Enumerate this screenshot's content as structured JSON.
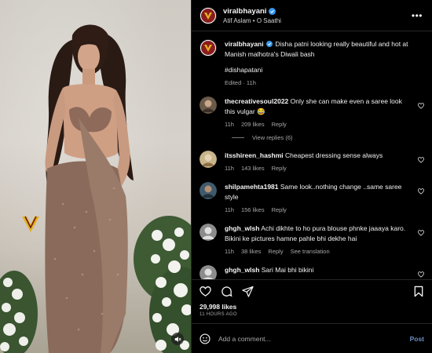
{
  "header": {
    "username": "viralbhayani",
    "subtitle": "Atif Aslam • O Saathi",
    "more_icon": "more-horizontal-icon"
  },
  "caption": {
    "username": "viralbhayani",
    "text": "Disha patni looking really beautiful and hot at Manish malhotra's Diwali bash",
    "hashtag": "#dishapatani",
    "edited": "Edited · 11h"
  },
  "comments": [
    {
      "username": "thecreativesoul2022",
      "text": "Only she can make even a saree look this vulgar 😂",
      "time": "11h",
      "likes": "209 likes",
      "reply": "Reply",
      "avatar_color": "#6b5a4a"
    },
    {
      "username": "itsshireen_hashmi",
      "text": "Cheapest dressing sense always",
      "time": "11h",
      "likes": "143 likes",
      "reply": "Reply",
      "avatar_color": "#c8b48a"
    },
    {
      "username": "shilpamehta1981",
      "text": "Same look..nothing change ..same saree style",
      "time": "11h",
      "likes": "156 likes",
      "reply": "Reply",
      "avatar_color": "#3f5a6b"
    },
    {
      "username": "ghgh_wlsh",
      "text": "Achi dikhte to ho pura blouse phnke jaaaya karo. Bikini ke pictures hamne pahle bhi dekhe hai",
      "time": "11h",
      "likes": "38 likes",
      "reply": "Reply",
      "translation": "See translation",
      "avatar_color": "#8c8c8c"
    },
    {
      "username": "ghgh_wlsh",
      "text": "Sari Mai bhi bikini",
      "avatar_color": "#8c8c8c"
    }
  ],
  "view_replies": "View replies (6)",
  "likes_count": "29,998 likes",
  "time_ago": "11 HOURS AGO",
  "add_comment": {
    "placeholder": "Add a comment...",
    "post_label": "Post"
  },
  "colors": {
    "background": "#000000",
    "divider": "#262626",
    "muted": "#a8a8a8",
    "post_button": "#6b8fbf",
    "verified": "#3897f0"
  }
}
